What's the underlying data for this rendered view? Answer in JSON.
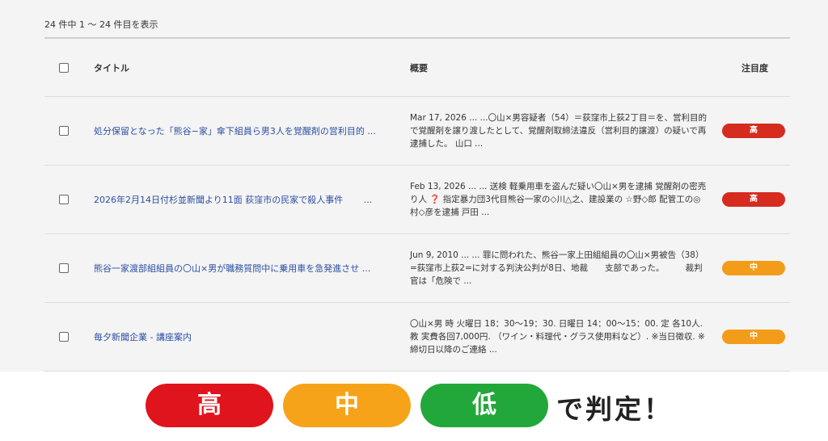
{
  "result_count": "24 件中 1 〜 24 件目を表示",
  "table": {
    "headers": {
      "title": "タイトル",
      "summary": "概要",
      "priority": "注目度"
    },
    "rows": [
      {
        "title": "処分保留となった「熊谷−家」傘下組員ら男3人を覚醒剤の営利目的 ...",
        "summary": "Mar 17, 2026 ... ...〇山×男容疑者（54）＝荻窪市上荻2丁目＝を、営利目的で覚醒剤を譲り渡したとして、覚醒剤取締法違反（営利目的譲渡）の疑いで再逮捕した。 山口 ...",
        "priority": "高",
        "level": "high"
      },
      {
        "title": "2026年2月14日付杉並新聞より11面 荻窪市の民家で殺人事件　　 ...",
        "summary": "Feb 13, 2026 ... ... 送検 軽乗用車を盗んだ疑い〇山×男を逮捕 覚醒剤の密売り人 ❓ 指定暴力団3代目熊谷一家の◇川△之、建設業の ☆野◇郎 配管工の◎村◇彦を逮捕 戸田 ...",
        "priority": "高",
        "level": "high"
      },
      {
        "title": "熊谷一家渡部組組員の〇山×男が職務質問中に乗用車を急発進させ ...",
        "summary": "Jun 9, 2010 ... ... 罪に問われた、熊谷一家上田組組員の〇山×男被告（38） =荻窪市上荻2=に対する判決公判が8日、地裁　　支部であった。　　　裁判官は「危険で ...",
        "priority": "中",
        "level": "mid"
      },
      {
        "title": "毎夕新聞企業 - 講座案内",
        "summary": "〇山×男 時 火曜日 18：30〜19：30. 日曜日 14：00〜15：00. 定 各10人. 教 実費各回7,000円. （ワイン・料理代・グラス使用料など）. ※当日徴収. ※締切日以降のご連絡 ...",
        "priority": "中",
        "level": "mid"
      }
    ]
  },
  "legend": {
    "high": "高",
    "mid": "中",
    "low": "低",
    "caption": "で判定！"
  },
  "colors": {
    "high": "#d62b1f",
    "mid": "#f39c19",
    "low": "#22a83a",
    "link": "#2b4ea3"
  }
}
